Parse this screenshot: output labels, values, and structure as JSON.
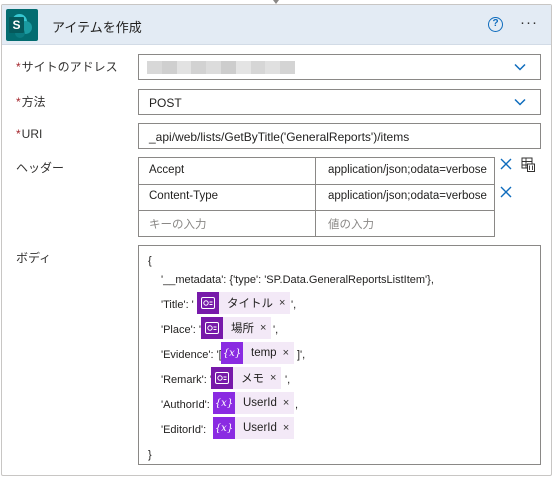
{
  "header": {
    "title": "アイテムを作成",
    "help_glyph": "?",
    "more_glyph": "···",
    "app_icon_letter": "S"
  },
  "fields": {
    "site_address": {
      "label": "サイトのアドレス",
      "required": true,
      "value": ""
    },
    "method": {
      "label": "方法",
      "required": true,
      "value": "POST"
    },
    "uri": {
      "label": "URI",
      "required": true,
      "value": "_api/web/lists/GetByTitle('GeneralReports')/items"
    },
    "headers": {
      "label": "ヘッダー",
      "rows": [
        {
          "key": "Accept",
          "value": "application/json;odata=verbose"
        },
        {
          "key": "Content-Type",
          "value": "application/json;odata=verbose"
        }
      ],
      "key_placeholder": "キーの入力",
      "value_placeholder": "値の入力"
    },
    "body": {
      "label": "ボディ",
      "open_brace": "{",
      "close_brace": "}",
      "metadata_line": "'__metadata': {'type': 'SP.Data.GeneralReportsListItem'},",
      "lines": [
        {
          "prefix": "'Title': '",
          "token": "タイトル",
          "token_type": "forms",
          "suffix": "',"
        },
        {
          "prefix": "'Place': '",
          "token": "場所",
          "token_type": "forms",
          "suffix": "',"
        },
        {
          "prefix": "'Evidence': '[",
          "token": "temp",
          "token_type": "variable",
          "suffix": "]',"
        },
        {
          "prefix": "'Remark': '",
          "token": "メモ",
          "token_type": "forms",
          "suffix": "',"
        },
        {
          "prefix": "'AuthorId':",
          "token": "UserId",
          "token_type": "variable",
          "suffix": ","
        },
        {
          "prefix": "'EditorId':",
          "token": "UserId",
          "token_type": "variable",
          "suffix": ""
        }
      ]
    }
  },
  "glyphs": {
    "required_mark": "*",
    "remove_token": "×",
    "variable_icon": "{x}"
  },
  "colors": {
    "header_bg": "#e3ebf4",
    "sharepoint": "#036c70",
    "accent_blue": "#0f6cbd",
    "forms_token_icon": "#7719aa",
    "variable_token_icon": "#8a2be2",
    "token_bg": "#f3e9f7",
    "required": "#a4262c"
  }
}
